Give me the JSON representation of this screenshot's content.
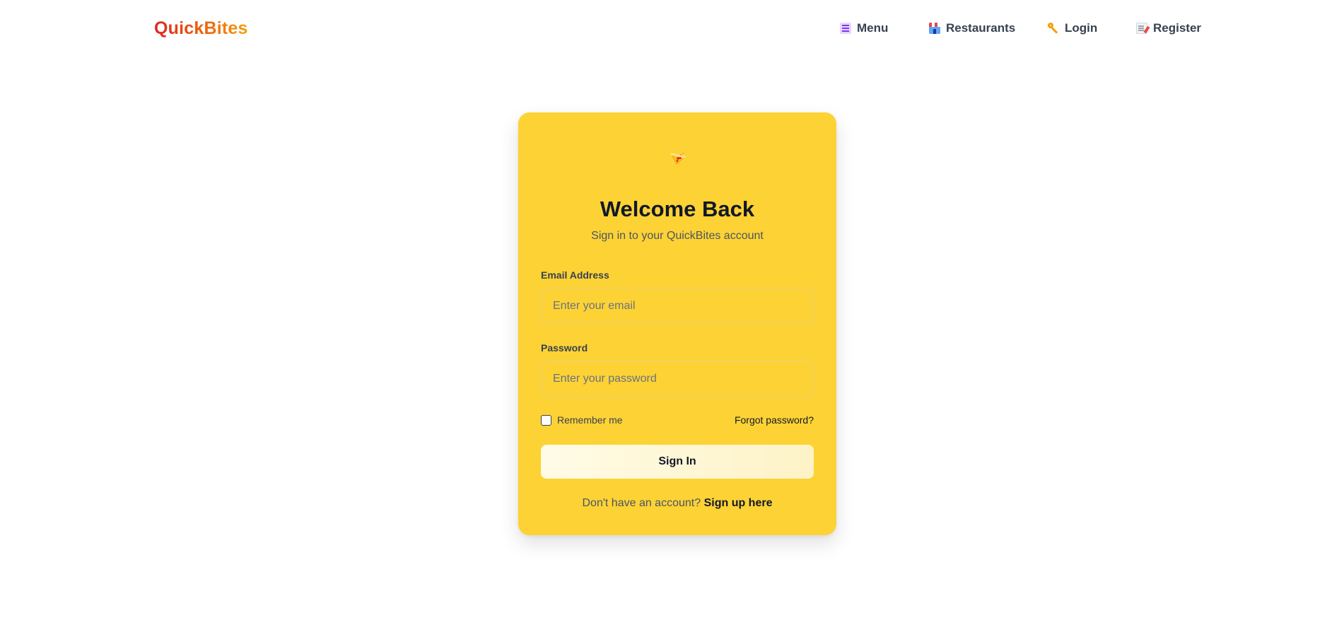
{
  "brand": {
    "name": "QuickBites",
    "gradient": [
      "#dc2626",
      "#ea580c",
      "#f59e0b"
    ]
  },
  "nav": {
    "items": [
      {
        "icon": "menu-icon",
        "label": "Menu"
      },
      {
        "icon": "restaurant-icon",
        "label": "Restaurants"
      },
      {
        "icon": "key-icon",
        "label": "Login"
      },
      {
        "icon": "register-icon",
        "label": "Register"
      }
    ]
  },
  "login": {
    "icon": "pizza-icon",
    "title": "Welcome Back",
    "subtitle": "Sign in to your QuickBites account",
    "email_label": "Email Address",
    "email_placeholder": "Enter your email",
    "email_value": "",
    "password_label": "Password",
    "password_placeholder": "Enter your password",
    "password_value": "",
    "remember_label": "Remember me",
    "remember_checked": false,
    "forgot_label": "Forgot password?",
    "submit_label": "Sign In",
    "signup_prompt": "Don't have an account?",
    "signup_link": "Sign up here"
  },
  "colors": {
    "card_background": "#fdd235",
    "button_background": "#fffbe6",
    "page_background": "#ffffff"
  }
}
